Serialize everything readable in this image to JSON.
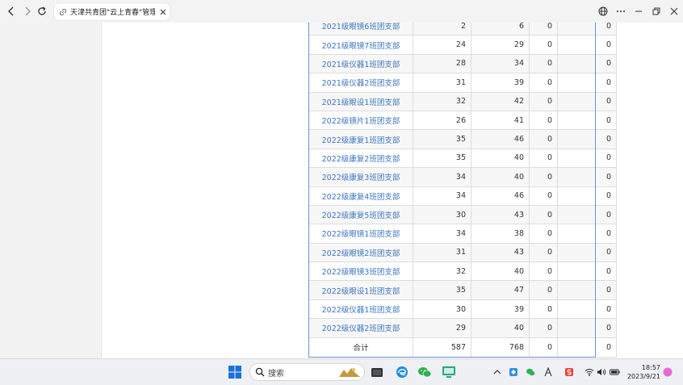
{
  "browser": {
    "tab_title": "天津共青团\"云上青春\"管理平台"
  },
  "table": {
    "rows": [
      {
        "name": "2021级眼镜6班团支部",
        "c1": "2",
        "c2": "6",
        "c3": "0",
        "c4": "0"
      },
      {
        "name": "2021级眼镜7班团支部",
        "c1": "24",
        "c2": "29",
        "c3": "0",
        "c4": "0"
      },
      {
        "name": "2021级仪器1班团支部",
        "c1": "28",
        "c2": "34",
        "c3": "0",
        "c4": "0"
      },
      {
        "name": "2021级仪器2班团支部",
        "c1": "31",
        "c2": "39",
        "c3": "0",
        "c4": "0"
      },
      {
        "name": "2021级眼设1班团支部",
        "c1": "32",
        "c2": "42",
        "c3": "0",
        "c4": "0"
      },
      {
        "name": "2022级镜片1班团支部",
        "c1": "26",
        "c2": "41",
        "c3": "0",
        "c4": "0"
      },
      {
        "name": "2022级康复1班团支部",
        "c1": "35",
        "c2": "46",
        "c3": "0",
        "c4": "0"
      },
      {
        "name": "2022级康复2班团支部",
        "c1": "35",
        "c2": "40",
        "c3": "0",
        "c4": "0"
      },
      {
        "name": "2022级康复3班团支部",
        "c1": "34",
        "c2": "40",
        "c3": "0",
        "c4": "0"
      },
      {
        "name": "2022级康复4班团支部",
        "c1": "34",
        "c2": "46",
        "c3": "0",
        "c4": "0"
      },
      {
        "name": "2022级康复5班团支部",
        "c1": "30",
        "c2": "43",
        "c3": "0",
        "c4": "0"
      },
      {
        "name": "2022级眼镜1班团支部",
        "c1": "34",
        "c2": "38",
        "c3": "0",
        "c4": "0"
      },
      {
        "name": "2022级眼镜2班团支部",
        "c1": "31",
        "c2": "43",
        "c3": "0",
        "c4": "0"
      },
      {
        "name": "2022级眼镜3班团支部",
        "c1": "32",
        "c2": "40",
        "c3": "0",
        "c4": "0"
      },
      {
        "name": "2022级眼设1班团支部",
        "c1": "35",
        "c2": "47",
        "c3": "0",
        "c4": "0"
      },
      {
        "name": "2022级仪器1班团支部",
        "c1": "30",
        "c2": "39",
        "c3": "0",
        "c4": "0"
      },
      {
        "name": "2022级仪器2班团支部",
        "c1": "29",
        "c2": "40",
        "c3": "0",
        "c4": "0"
      }
    ],
    "total": {
      "label": "合计",
      "c1": "587",
      "c2": "768",
      "c3": "0",
      "c4": "0"
    }
  },
  "taskbar": {
    "search_placeholder": "搜索",
    "time": "18:57",
    "date": "2023/9/21"
  },
  "colors": {
    "link": "#3a74c2",
    "frame": "#6d94c9"
  }
}
